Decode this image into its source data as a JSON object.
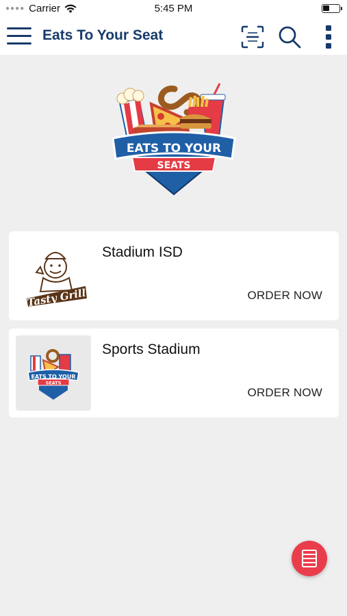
{
  "status_bar": {
    "carrier": "Carrier",
    "time": "5:45 PM"
  },
  "app_bar": {
    "title": "Eats To Your Seat"
  },
  "logo": {
    "line1": "EATS TO YOUR",
    "line2": "SEATS"
  },
  "venues": [
    {
      "name": "Stadium ISD",
      "action": "ORDER NOW",
      "thumb_text": "Tasty Grill"
    },
    {
      "name": "Sports Stadium",
      "action": "ORDER NOW",
      "thumb_text1": "EATS TO YOUR",
      "thumb_text2": "SEATS"
    }
  ],
  "colors": {
    "brand_navy": "#173a6b",
    "fab_red": "#ea3d4c",
    "logo_red": "#e43b45",
    "logo_blue": "#1f5fa6"
  },
  "icons": [
    "menu-icon",
    "scan-icon",
    "search-icon",
    "more-vertical-icon",
    "receipt-icon",
    "wifi-icon",
    "battery-icon"
  ]
}
